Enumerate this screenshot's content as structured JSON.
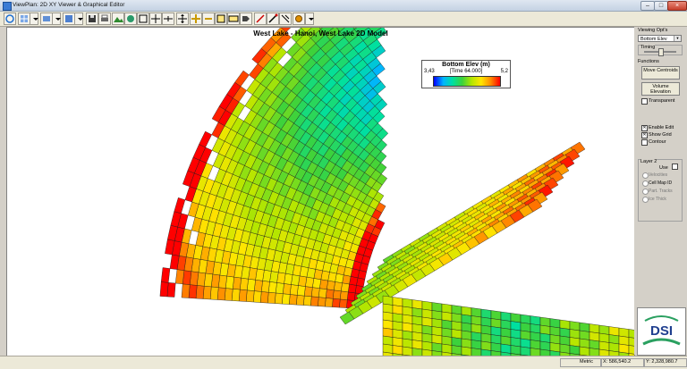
{
  "window": {
    "title": "ViewPlan: 2D XY Viewer & Graphical Editor"
  },
  "map": {
    "title": "West Lake - Hanoi, West Lake 2D Model"
  },
  "legend": {
    "title": "Bottom Elev (m)",
    "min": "3,43",
    "max": "5,2",
    "time": "[Time 64.000]"
  },
  "panel": {
    "viewing_opts_label": "Viewing Opt's",
    "viewing_opts_value": "Bottom Elev",
    "timing_label": "Timing",
    "functions_label": "Functions",
    "move_centroids": "Move Centroids",
    "volume_elevation": "Volume Elevation",
    "transparent": "Transparent",
    "enable_edit": "Enable Edit",
    "show_grid": "Show Grid",
    "contour": "Contour",
    "layer2": "Layer 2",
    "use": "Use",
    "velocities": "Velocities",
    "cell_map_id": "Cell Map ID",
    "part_tracks": "Part. Tracks",
    "ice_thick": "Ice Thick",
    "logo": "DSI"
  },
  "status": {
    "units": "Metric",
    "x": "X: 586,540.2",
    "y": "Y: 2,328,980.7"
  }
}
